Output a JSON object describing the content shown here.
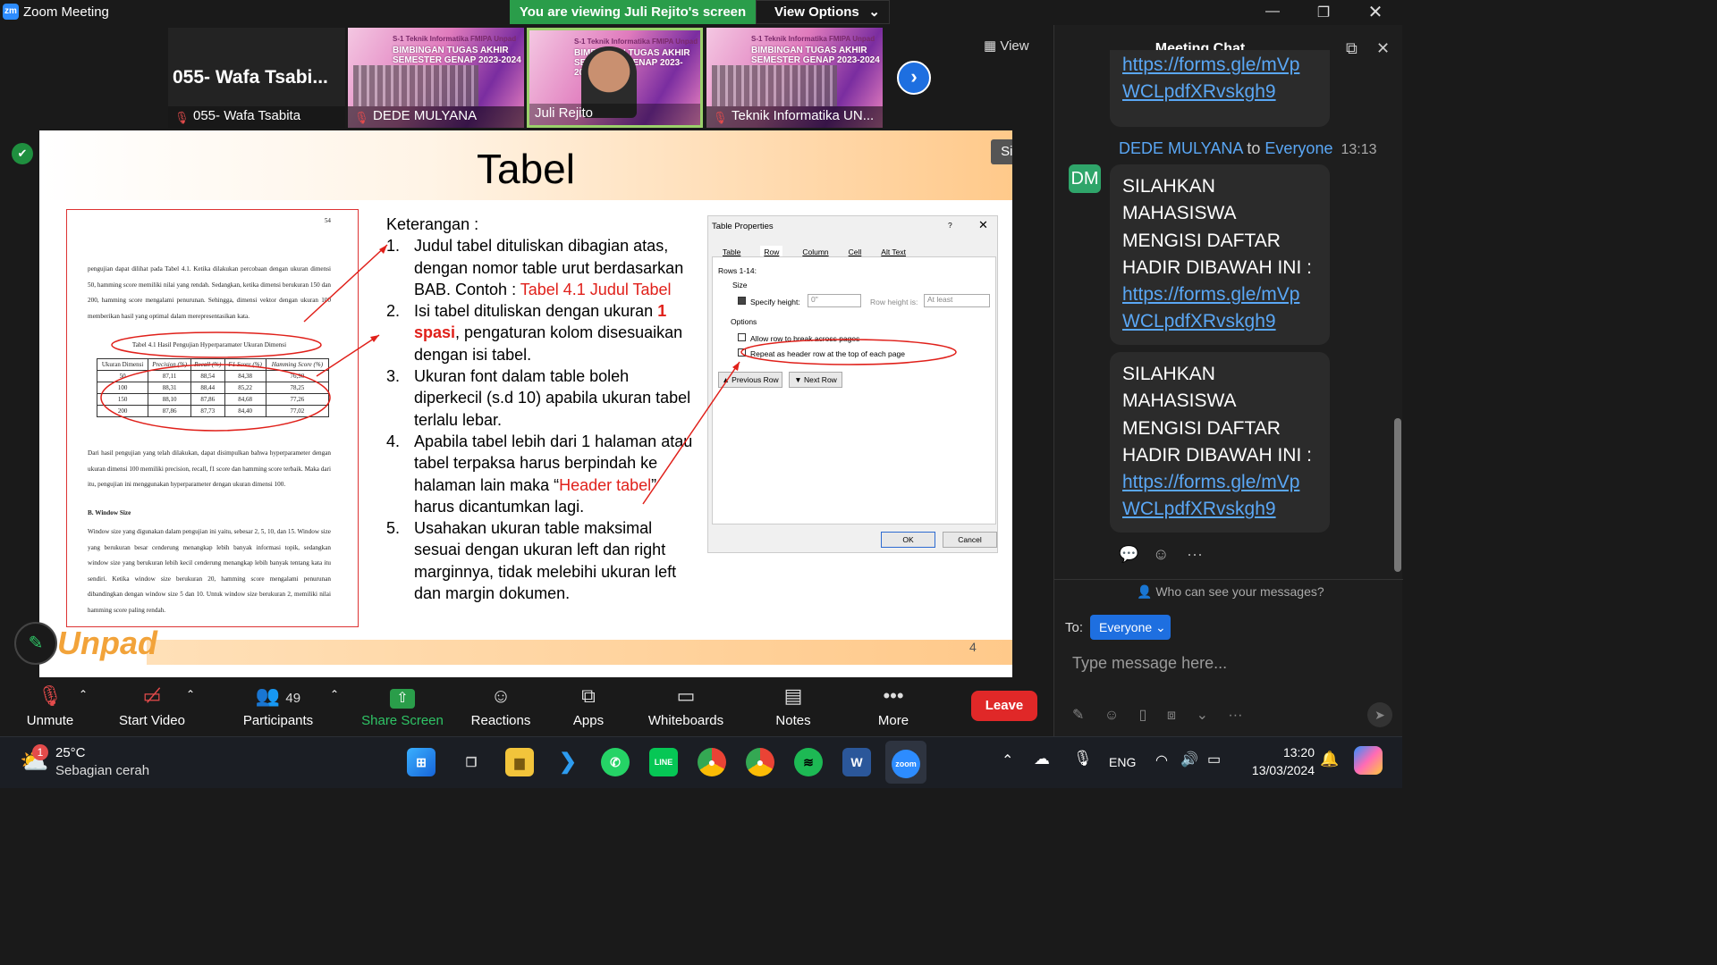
{
  "window": {
    "title": "Zoom Meeting",
    "logo_text": "zm"
  },
  "banner": {
    "viewing": "You are viewing Juli Rejito's screen",
    "view_options": "View Options"
  },
  "participants_strip": {
    "namecard_big": "055- Wafa Tsabi...",
    "namecard_label": "055- Wafa Tsabita",
    "tiles": [
      {
        "label": "DEDE MULYANA",
        "muted": true
      },
      {
        "label": "Juli Rejito",
        "muted": false
      },
      {
        "label": "Teknik Informatika UN...",
        "muted": true
      }
    ],
    "tile_header": "S-1 Teknik Informatika FMIPA Unpad",
    "tile_title_1": "BIMBINGAN TUGAS AKHIR",
    "tile_title_2": "SEMESTER GENAP 2023-2024",
    "view_label": "View"
  },
  "slide": {
    "title": "Tabel",
    "sign_in": "Sign in",
    "page_number": "4",
    "logo_text": "Unpad",
    "doc": {
      "page_no": "54",
      "para1": "pengujian dapat dilihat pada Tabel 4.1. Ketika dilakukan percobaan dengan ukuran dimensi 50, hamming score memiliki nilai yang rendah. Sedangkan, ketika dimensi berukuran 150 dan 200, hamming score mengalami penurunan. Sehingga, dimensi vektor dengan ukuran 100 memberikan hasil yang optimal dalam merepresentasikan kata.",
      "caption": "Tabel 4.1 Hasil Pengujian Hyperparamater Ukuran Dimensi",
      "table_header": [
        "Ukuran Dimensi",
        "Precision (%)",
        "Recall (%)",
        "F1 Score (%)",
        "Hamming Score (%)"
      ],
      "table_rows": [
        [
          "50",
          "87,11",
          "88,54",
          "84,38",
          "76,90"
        ],
        [
          "100",
          "88,31",
          "88,44",
          "85,22",
          "78,25"
        ],
        [
          "150",
          "88,10",
          "87,86",
          "84,68",
          "77,26"
        ],
        [
          "200",
          "87,86",
          "87,73",
          "84,40",
          "77,02"
        ]
      ],
      "para2": "Dari hasil pengujian yang telah dilakukan, dapat disimpulkan bahwa hyperparameter dengan ukuran dimensi 100 memiliki precision, recall, f1 score dan hamming score terbaik. Maka dari itu, pengujian ini menggunakan hyperparameter dengan ukuran dimensi 100.",
      "section": "B.    Window Size",
      "para3": "Window size yang digunakan dalam pengujian ini yaitu, sebesar 2, 5, 10, dan 15. Window size yang berukuran besar cenderung menangkap lebih banyak informasi topik, sedangkan window size yang berukuran lebih kecil cenderung menangkap lebih banyak tentang kata itu sendiri. Ketika window size berukuran 20, hamming score mengalami penurunan dibandingkan dengan window size 5 dan 10. Untuk window size berukuran 2, memiliki nilai hamming score paling rendah."
    },
    "notes_heading": "Keterangan :",
    "notes": [
      {
        "num": "1.",
        "a": "Judul tabel dituliskan dibagian atas, dengan nomor table urut berdasarkan BAB. Contoh : ",
        "red": "Tabel 4.1 Judul Tabel",
        "b": ""
      },
      {
        "num": "2.",
        "a": "Isi tabel dituliskan dengan ukuran ",
        "red": "1 spasi",
        "b": ", pengaturan kolom disesuaikan dengan isi tabel."
      },
      {
        "num": "3.",
        "a": "Ukuran font dalam table boleh diperkecil (s.d 10) apabila ukuran tabel terlalu lebar.",
        "red": "",
        "b": ""
      },
      {
        "num": "4.",
        "a": "Apabila tabel lebih dari 1 halaman atau tabel terpaksa harus berpindah ke halaman lain maka “",
        "red": "Header tabel",
        "b": "” harus dicantumkan lagi."
      },
      {
        "num": "5.",
        "a": "Usahakan ukuran table maksimal sesuai dengan ukuran left dan right marginnya, tidak melebihi ukuran left dan margin dokumen.",
        "red": "",
        "b": ""
      }
    ],
    "dialog": {
      "title": "Table Properties",
      "help": "?",
      "tabs": [
        "Table",
        "Row",
        "Column",
        "Cell",
        "Alt Text"
      ],
      "rows_label": "Rows 1-14:",
      "size_label": "Size",
      "specify_height": "Specify height:",
      "height_value": "0\"",
      "row_height_is": "Row height is:",
      "at_least": "At least",
      "options_label": "Options",
      "opt1": "Allow row to break across pages",
      "opt2": "Repeat as header row at the top of each page",
      "prev_row": "Previous Row",
      "next_row": "Next Row",
      "ok": "OK",
      "cancel": "Cancel"
    }
  },
  "toolbar": {
    "unmute": "Unmute",
    "start_video": "Start Video",
    "participants": "Participants",
    "participants_count": "49",
    "share_screen": "Share Screen",
    "reactions": "Reactions",
    "apps": "Apps",
    "whiteboards": "Whiteboards",
    "notes": "Notes",
    "more": "More",
    "leave": "Leave"
  },
  "chat": {
    "title": "Meeting Chat",
    "prev_link_1": "https://forms.gle/mVp",
    "prev_link_2": "WCLpdfXRvskgh9",
    "sender": "DEDE MULYANA",
    "to": "to",
    "recipient": "Everyone",
    "time": "13:13",
    "avatar": "DM",
    "msg_text": "SILAHKAN MAHASISWA MENGISI DAFTAR HADIR DIBAWAH INI :",
    "msg_link_1": "https://forms.gle/mVp",
    "msg_link_2": "WCLpdfXRvskgh9",
    "who_can_see": "Who can see your messages?",
    "to_label": "To:",
    "to_value": "Everyone",
    "input_placeholder": "Type message here..."
  },
  "taskbar": {
    "weather_temp": "25°C",
    "weather_desc": "Sebagian cerah",
    "weather_badge": "1",
    "lang": "ENG",
    "time": "13:20",
    "date": "13/03/2024"
  }
}
